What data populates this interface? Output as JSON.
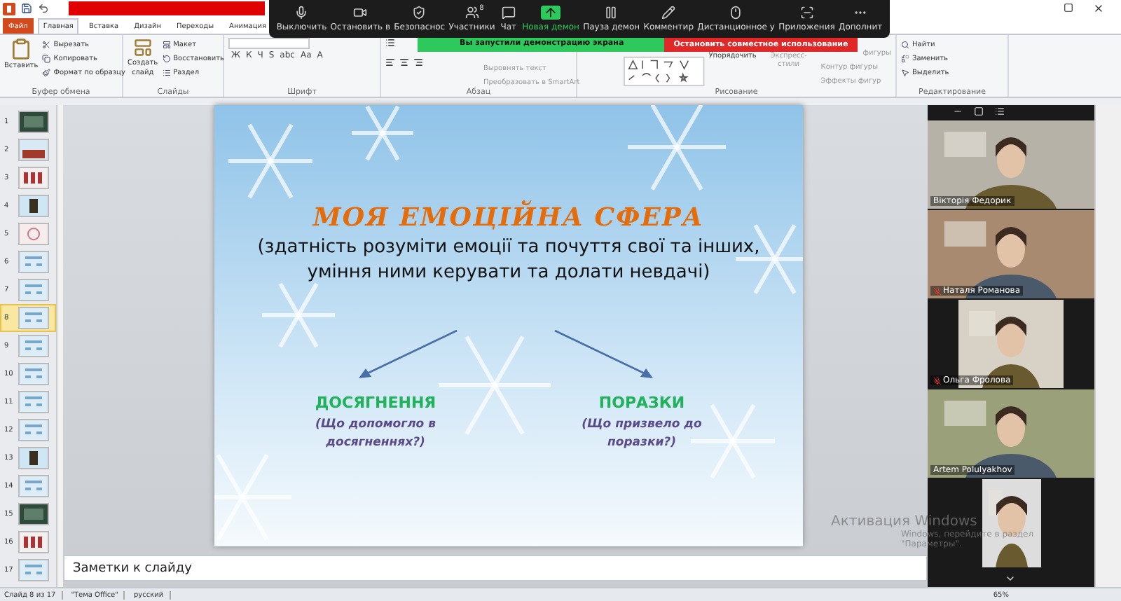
{
  "tabs": [
    {
      "label": "Файл",
      "kind": "file",
      "selected": false
    },
    {
      "label": "Главная",
      "kind": "tab",
      "selected": true
    },
    {
      "label": "Вставка",
      "kind": "tab",
      "selected": false
    },
    {
      "label": "Дизайн",
      "kind": "tab",
      "selected": false
    },
    {
      "label": "Переходы",
      "kind": "tab",
      "selected": false
    },
    {
      "label": "Анимация",
      "kind": "tab",
      "selected": false
    }
  ],
  "ribbon": {
    "clipboard": {
      "label": "Буфер обмена",
      "large": "Вставить",
      "small": [
        "Вырезать",
        "Копировать",
        "Формат по образцу"
      ]
    },
    "slides": {
      "label": "Слайды",
      "large": [
        "Создать",
        "слайд"
      ],
      "small": [
        "Макет",
        "Восстановить",
        "Раздел"
      ]
    },
    "font": {
      "label": "Шрифт",
      "buttons": [
        "Ж",
        "К",
        "Ч",
        "S",
        "abc",
        "Aa",
        "A"
      ]
    },
    "paragraph": {
      "label": "Абзац",
      "small": [
        "Выровнять текст",
        "Преобразовать в SmartArt"
      ]
    },
    "drawing": {
      "label": "Рисование",
      "large": "Упорядочить",
      "styles": "Экспресс-стили",
      "small": [
        "фигуры",
        "Контур фигуры",
        "Эффекты фигур"
      ]
    },
    "editing": {
      "label": "Редактирование",
      "small": [
        "Найти",
        "Заменить",
        "Выделить"
      ]
    }
  },
  "zoom_toolbar": {
    "items": [
      {
        "label": "Выключить",
        "kind": "mic"
      },
      {
        "label": "Остановить в",
        "kind": "camera"
      },
      {
        "label": "Безопаснос",
        "kind": "shield"
      },
      {
        "label": "Участники",
        "kind": "people",
        "badge": "8"
      },
      {
        "label": "Чат",
        "kind": "chat"
      },
      {
        "label": "Новая демон",
        "kind": "share"
      },
      {
        "label": "Пауза демон",
        "kind": "pause"
      },
      {
        "label": "Комментир",
        "kind": "pen"
      },
      {
        "label": "Дистанционное у",
        "kind": "mouse"
      },
      {
        "label": "Приложения",
        "kind": "apps"
      },
      {
        "label": "Дополнит",
        "kind": "more"
      }
    ],
    "sharing_banner": "Вы запустили демонстрацию экрана",
    "stop_button": "Остановить совместное использование"
  },
  "slides_panel": [
    {
      "number": "1",
      "kind": "dark",
      "selected": false
    },
    {
      "number": "2",
      "selected": false
    },
    {
      "number": "3",
      "kind": "grid",
      "selected": false
    },
    {
      "number": "4",
      "kind": "portrait",
      "selected": false
    },
    {
      "number": "5",
      "kind": "pattern",
      "selected": false
    },
    {
      "number": "6",
      "kind": "snow",
      "selected": false
    },
    {
      "number": "7",
      "kind": "snow",
      "selected": false
    },
    {
      "number": "8",
      "kind": "snow",
      "selected": true
    },
    {
      "number": "9",
      "kind": "snow",
      "selected": false
    },
    {
      "number": "10",
      "kind": "snow",
      "selected": false
    },
    {
      "number": "11",
      "kind": "snow",
      "selected": false
    },
    {
      "number": "12",
      "kind": "snow",
      "selected": false
    },
    {
      "number": "13",
      "kind": "portrait",
      "selected": false
    },
    {
      "number": "14",
      "kind": "snow",
      "selected": false
    },
    {
      "number": "15",
      "kind": "dark",
      "selected": false
    },
    {
      "number": "16",
      "kind": "grid",
      "selected": false
    },
    {
      "number": "17",
      "kind": "snow",
      "selected": false
    }
  ],
  "slide": {
    "title": "МОЯ ЕМОЦІЙНА СФЕРА",
    "subtitle": "(здатність розуміти емоції та почуття свої та інших, уміння ними керувати та долати невдачі)",
    "branches": [
      {
        "heading": "ДОСЯГНЕННЯ",
        "note": "(Що допомогло в досягненнях?)"
      },
      {
        "heading": "ПОРАЗКИ",
        "note": "(Що призвело до поразки?)"
      }
    ]
  },
  "notes": {
    "placeholder": "Заметки к слайду"
  },
  "activation": [
    "Активация Windows",
    "Windows, перейдите в раздел",
    "\"Параметры\"."
  ],
  "participants": [
    {
      "name": "Вікторія Федорик",
      "muted": false,
      "kind": "wide"
    },
    {
      "name": "Наталя Романова",
      "muted": true,
      "kind": "wide"
    },
    {
      "name": "Ольга Фролова",
      "muted": true,
      "kind": "narrow"
    },
    {
      "name": "Artem Polulyakhov",
      "muted": false,
      "kind": "wide"
    },
    {
      "kind": "portrait"
    }
  ],
  "status_bar": {
    "items": [
      "Слайд 8 из 17",
      "\"Тема Office\"",
      "русский"
    ],
    "zoom": "65%"
  }
}
